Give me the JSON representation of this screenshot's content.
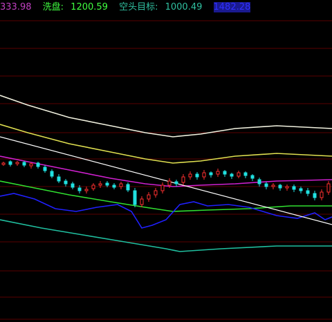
{
  "legend": {
    "item1": {
      "label": "",
      "value": "333.98",
      "color": "#c040c0"
    },
    "item2": {
      "label": "洗盘:",
      "value": "1200.59",
      "color": "#40ff40"
    },
    "item3": {
      "label": "空头目标:",
      "value": "1000.49",
      "color": "#30c0a0"
    },
    "item4": {
      "label": "",
      "value": "1482.28",
      "color": "#4040ff"
    }
  },
  "chart_data": {
    "type": "line",
    "grid": true,
    "series": [
      {
        "color": "#f2f2e0",
        "points": [
          [
            0,
            138
          ],
          [
            40,
            152
          ],
          [
            100,
            170
          ],
          [
            160,
            182
          ],
          [
            210,
            192
          ],
          [
            250,
            198
          ],
          [
            290,
            194
          ],
          [
            340,
            186
          ],
          [
            400,
            182
          ],
          [
            480,
            186
          ]
        ]
      },
      {
        "color": "#e0e050",
        "points": [
          [
            0,
            180
          ],
          [
            40,
            192
          ],
          [
            100,
            208
          ],
          [
            160,
            220
          ],
          [
            210,
            230
          ],
          [
            250,
            236
          ],
          [
            290,
            233
          ],
          [
            340,
            226
          ],
          [
            400,
            222
          ],
          [
            480,
            226
          ]
        ]
      },
      {
        "color": "#d020d0",
        "points": [
          [
            0,
            226
          ],
          [
            40,
            234
          ],
          [
            100,
            246
          ],
          [
            160,
            258
          ],
          [
            210,
            266
          ],
          [
            250,
            270
          ],
          [
            290,
            268
          ],
          [
            340,
            266
          ],
          [
            400,
            262
          ],
          [
            480,
            260
          ]
        ]
      },
      {
        "color": "#30e030",
        "points": [
          [
            0,
            262
          ],
          [
            40,
            270
          ],
          [
            100,
            282
          ],
          [
            160,
            292
          ],
          [
            210,
            300
          ],
          [
            250,
            306
          ],
          [
            300,
            304
          ],
          [
            360,
            302
          ],
          [
            420,
            298
          ],
          [
            480,
            298
          ]
        ]
      },
      {
        "color": "#20c0a0",
        "points": [
          [
            0,
            318
          ],
          [
            60,
            330
          ],
          [
            120,
            340
          ],
          [
            180,
            350
          ],
          [
            240,
            360
          ],
          [
            260,
            364
          ],
          [
            320,
            360
          ],
          [
            400,
            356
          ],
          [
            480,
            356
          ]
        ]
      },
      {
        "color": "#2020ff",
        "points": [
          [
            0,
            284
          ],
          [
            20,
            280
          ],
          [
            50,
            288
          ],
          [
            80,
            302
          ],
          [
            110,
            306
          ],
          [
            140,
            300
          ],
          [
            170,
            296
          ],
          [
            190,
            306
          ],
          [
            205,
            330
          ],
          [
            220,
            326
          ],
          [
            240,
            318
          ],
          [
            260,
            296
          ],
          [
            280,
            292
          ],
          [
            300,
            298
          ],
          [
            330,
            296
          ],
          [
            360,
            300
          ],
          [
            400,
            312
          ],
          [
            430,
            316
          ],
          [
            455,
            308
          ],
          [
            470,
            318
          ],
          [
            480,
            314
          ]
        ]
      },
      {
        "color": "#ffffff",
        "points": [
          [
            0,
            198
          ],
          [
            480,
            325
          ]
        ]
      }
    ],
    "candles": [
      [
        5,
        238,
        236,
        240,
        234
      ],
      [
        15,
        234,
        238,
        241,
        232
      ],
      [
        25,
        237,
        235,
        240,
        233
      ],
      [
        35,
        235,
        239,
        242,
        233
      ],
      [
        45,
        240,
        237,
        244,
        235
      ],
      [
        55,
        236,
        241,
        244,
        234
      ],
      [
        65,
        242,
        247,
        250,
        239
      ],
      [
        75,
        248,
        255,
        258,
        245
      ],
      [
        85,
        256,
        262,
        265,
        252
      ],
      [
        95,
        262,
        266,
        270,
        259
      ],
      [
        105,
        266,
        271,
        274,
        263
      ],
      [
        115,
        272,
        276,
        280,
        268
      ],
      [
        125,
        276,
        274,
        280,
        270
      ],
      [
        135,
        273,
        268,
        276,
        265
      ],
      [
        145,
        268,
        266,
        272,
        262
      ],
      [
        155,
        265,
        268,
        271,
        262
      ],
      [
        165,
        268,
        271,
        274,
        265
      ],
      [
        175,
        270,
        266,
        274,
        263
      ],
      [
        185,
        267,
        275,
        278,
        264
      ],
      [
        195,
        276,
        296,
        300,
        272
      ],
      [
        205,
        296,
        288,
        300,
        284
      ],
      [
        215,
        288,
        282,
        292,
        278
      ],
      [
        225,
        282,
        276,
        286,
        272
      ],
      [
        235,
        276,
        268,
        280,
        264
      ],
      [
        245,
        268,
        262,
        272,
        258
      ],
      [
        255,
        263,
        266,
        270,
        260
      ],
      [
        265,
        264,
        256,
        268,
        252
      ],
      [
        275,
        256,
        252,
        260,
        248
      ],
      [
        285,
        252,
        256,
        260,
        249
      ],
      [
        295,
        256,
        250,
        260,
        246
      ],
      [
        305,
        250,
        253,
        257,
        248
      ],
      [
        315,
        252,
        248,
        256,
        244
      ],
      [
        325,
        248,
        252,
        256,
        246
      ],
      [
        335,
        252,
        255,
        259,
        250
      ],
      [
        345,
        255,
        250,
        258,
        247
      ],
      [
        355,
        250,
        254,
        258,
        248
      ],
      [
        365,
        254,
        258,
        262,
        252
      ],
      [
        375,
        260,
        266,
        270,
        257
      ],
      [
        385,
        266,
        270,
        274,
        263
      ],
      [
        395,
        270,
        268,
        274,
        265
      ],
      [
        405,
        268,
        272,
        276,
        266
      ],
      [
        415,
        272,
        270,
        276,
        267
      ],
      [
        425,
        270,
        274,
        278,
        267
      ],
      [
        435,
        273,
        276,
        280,
        270
      ],
      [
        445,
        276,
        280,
        284,
        272
      ],
      [
        455,
        280,
        286,
        290,
        276
      ],
      [
        465,
        286,
        278,
        290,
        274
      ],
      [
        475,
        278,
        266,
        282,
        262
      ]
    ]
  }
}
